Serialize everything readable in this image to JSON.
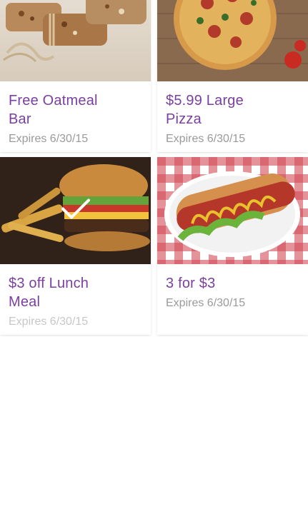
{
  "colors": {
    "accent": "#7a3fa0",
    "muted": "#9a9a9a"
  },
  "offers": [
    {
      "title": "Free Oatmeal Bar",
      "title_line1": "Free Oatmeal",
      "title_line2": "Bar",
      "expires": "Expires 6/30/15",
      "selected": false
    },
    {
      "title": "$5.99 Large Pizza",
      "title_line1": "$5.99 Large",
      "title_line2": "Pizza",
      "expires": "Expires 6/30/15",
      "selected": false
    },
    {
      "title": "$3 off Lunch Meal",
      "title_line1": "$3 off Lunch",
      "title_line2": "Meal",
      "expires": "Expires 6/30/15",
      "selected": true,
      "check_icon": "checkmark-icon"
    },
    {
      "title": "3 for $3",
      "title_line1": "3 for $3",
      "title_line2": "",
      "expires": "Expires 6/30/15",
      "selected": false
    }
  ]
}
